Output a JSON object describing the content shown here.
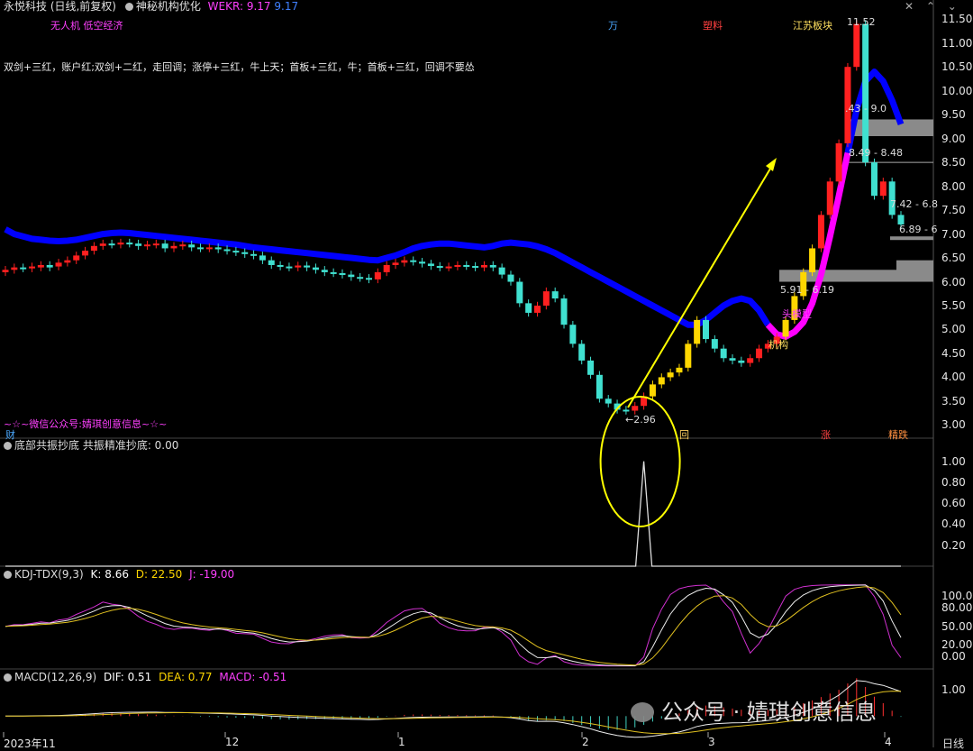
{
  "header": {
    "stock": "永悦科技 (日线,前复权)",
    "indicator": "神秘机构优化",
    "wekr_label": "WEKR: 9.17",
    "wekr_value": "9.17",
    "tags": [
      "无人机 低空经济",
      "万",
      "塑料",
      "江苏板块",
      "11.52"
    ],
    "rules": "双剑+三红，账户红;双剑+二红，走回调；涨停+三红，牛上天；首板+三红，牛；首板+三红，回调不要怂",
    "wechat": "~☆~微信公众号:婧琪创意信息~☆~",
    "bottom_tags": [
      "财",
      "回",
      "涨",
      "精跌"
    ],
    "chart_labels": [
      "头模型",
      "机构",
      "←2.96",
      "8.49 - 8.48",
      "5.91 - 6.19",
      "7.42 - 6.8",
      "6.89 - 6",
      ".43 - 9.0"
    ]
  },
  "panels": {
    "p2_title": "底部共振抄底 共振精准抄底: 0.00",
    "kdj_title": "KDJ-TDX(9,3)",
    "kdj_k": "K: 8.66",
    "kdj_d": "D: 22.50",
    "kdj_j": "J: -19.00",
    "macd_title": "MACD(12,26,9)",
    "macd_dif": "DIF: 0.51",
    "macd_dea": "DEA: 0.77",
    "macd_val": "MACD: -0.51"
  },
  "watermark": "公众号 · 婧琪创意信息",
  "period_label": "日线",
  "colors": {
    "up": "#ff2020",
    "down": "#40e0d0",
    "ma": "#0000ff",
    "accent": "#ff00ff",
    "yellow": "#ffff00",
    "bull": "#ffd700"
  },
  "chart_data": [
    {
      "type": "candlestick",
      "x_labels": [
        "2023年11",
        "12",
        "1",
        "2",
        "3",
        "4"
      ],
      "y_ticks": [
        3.0,
        3.5,
        4.0,
        4.5,
        5.0,
        5.5,
        6.0,
        6.5,
        7.0,
        7.5,
        8.0,
        8.5,
        9.0,
        9.5,
        10.0,
        10.5,
        11.0,
        11.5
      ],
      "ylim": [
        2.8,
        11.75
      ],
      "close": [
        6.25,
        6.3,
        6.28,
        6.32,
        6.35,
        6.3,
        6.4,
        6.45,
        6.55,
        6.65,
        6.75,
        6.8,
        6.78,
        6.82,
        6.8,
        6.75,
        6.78,
        6.8,
        6.7,
        6.75,
        6.78,
        6.72,
        6.7,
        6.72,
        6.68,
        6.65,
        6.62,
        6.58,
        6.55,
        6.45,
        6.35,
        6.32,
        6.3,
        6.34,
        6.3,
        6.25,
        6.2,
        6.18,
        6.15,
        6.1,
        6.08,
        6.05,
        6.2,
        6.35,
        6.4,
        6.45,
        6.42,
        6.38,
        6.33,
        6.3,
        6.32,
        6.35,
        6.33,
        6.3,
        6.35,
        6.3,
        6.15,
        6.0,
        5.55,
        5.35,
        5.5,
        5.8,
        5.65,
        5.1,
        4.7,
        4.35,
        4.05,
        3.55,
        3.45,
        3.32,
        3.3,
        3.4,
        3.6,
        3.85,
        4.0,
        4.1,
        4.2,
        4.7,
        5.2,
        4.8,
        4.6,
        4.4,
        4.35,
        4.3,
        4.4,
        4.6,
        4.7,
        4.85,
        5.2,
        5.7,
        6.2,
        6.7,
        7.4,
        8.1,
        8.9,
        10.5,
        11.4,
        8.5,
        7.8,
        8.1,
        7.4,
        7.2
      ],
      "open": [
        6.2,
        6.25,
        6.3,
        6.28,
        6.3,
        6.35,
        6.32,
        6.4,
        6.45,
        6.55,
        6.65,
        6.75,
        6.8,
        6.78,
        6.82,
        6.8,
        6.75,
        6.78,
        6.8,
        6.7,
        6.75,
        6.78,
        6.72,
        6.7,
        6.72,
        6.68,
        6.65,
        6.62,
        6.58,
        6.55,
        6.45,
        6.35,
        6.32,
        6.3,
        6.34,
        6.3,
        6.25,
        6.2,
        6.18,
        6.15,
        6.1,
        6.08,
        6.05,
        6.2,
        6.35,
        6.4,
        6.45,
        6.42,
        6.38,
        6.33,
        6.3,
        6.32,
        6.35,
        6.33,
        6.3,
        6.35,
        6.3,
        6.15,
        6.0,
        5.55,
        5.35,
        5.5,
        5.8,
        5.65,
        5.1,
        4.7,
        4.35,
        4.05,
        3.55,
        3.45,
        3.32,
        3.3,
        3.4,
        3.6,
        3.85,
        4.0,
        4.1,
        4.2,
        4.7,
        5.2,
        4.8,
        4.6,
        4.4,
        4.35,
        4.3,
        4.4,
        4.6,
        4.7,
        4.85,
        5.2,
        5.7,
        6.2,
        6.7,
        7.4,
        8.1,
        8.9,
        10.5,
        11.4,
        8.5,
        7.8,
        8.1,
        7.4
      ],
      "ma": [
        7.1,
        7.0,
        6.95,
        6.9,
        6.88,
        6.86,
        6.85,
        6.86,
        6.88,
        6.92,
        6.96,
        7.0,
        7.02,
        7.03,
        7.02,
        7.0,
        6.98,
        6.96,
        6.94,
        6.92,
        6.9,
        6.88,
        6.86,
        6.84,
        6.82,
        6.8,
        6.78,
        6.75,
        6.72,
        6.7,
        6.68,
        6.66,
        6.64,
        6.62,
        6.6,
        6.58,
        6.56,
        6.54,
        6.52,
        6.5,
        6.48,
        6.46,
        6.45,
        6.5,
        6.55,
        6.62,
        6.7,
        6.75,
        6.78,
        6.8,
        6.8,
        6.78,
        6.76,
        6.74,
        6.72,
        6.75,
        6.8,
        6.82,
        6.8,
        6.78,
        6.74,
        6.68,
        6.6,
        6.5,
        6.4,
        6.3,
        6.2,
        6.1,
        6.0,
        5.9,
        5.8,
        5.7,
        5.6,
        5.5,
        5.4,
        5.3,
        5.2,
        5.1,
        5.1,
        5.2,
        5.35,
        5.5,
        5.6,
        5.65,
        5.6,
        5.4,
        5.1,
        4.9,
        4.85,
        4.95,
        5.15,
        5.55,
        6.15,
        6.95,
        7.8,
        8.7,
        9.6,
        10.2,
        10.4,
        10.2,
        9.8,
        9.3
      ]
    },
    {
      "type": "line",
      "name": "共振精准抄底",
      "ylim": [
        0,
        1.1
      ],
      "y_ticks": [
        0.2,
        0.4,
        0.6,
        0.8,
        1.0
      ],
      "spike_index": 72,
      "spike_value": 1.0
    },
    {
      "type": "line",
      "name": "KDJ",
      "y_ticks": [
        0,
        20,
        50,
        80,
        100
      ],
      "ylim": [
        -20,
        125
      ]
    },
    {
      "type": "line",
      "name": "MACD",
      "y_ticks": [
        1.0
      ],
      "ylim": [
        -0.6,
        1.3
      ]
    }
  ]
}
